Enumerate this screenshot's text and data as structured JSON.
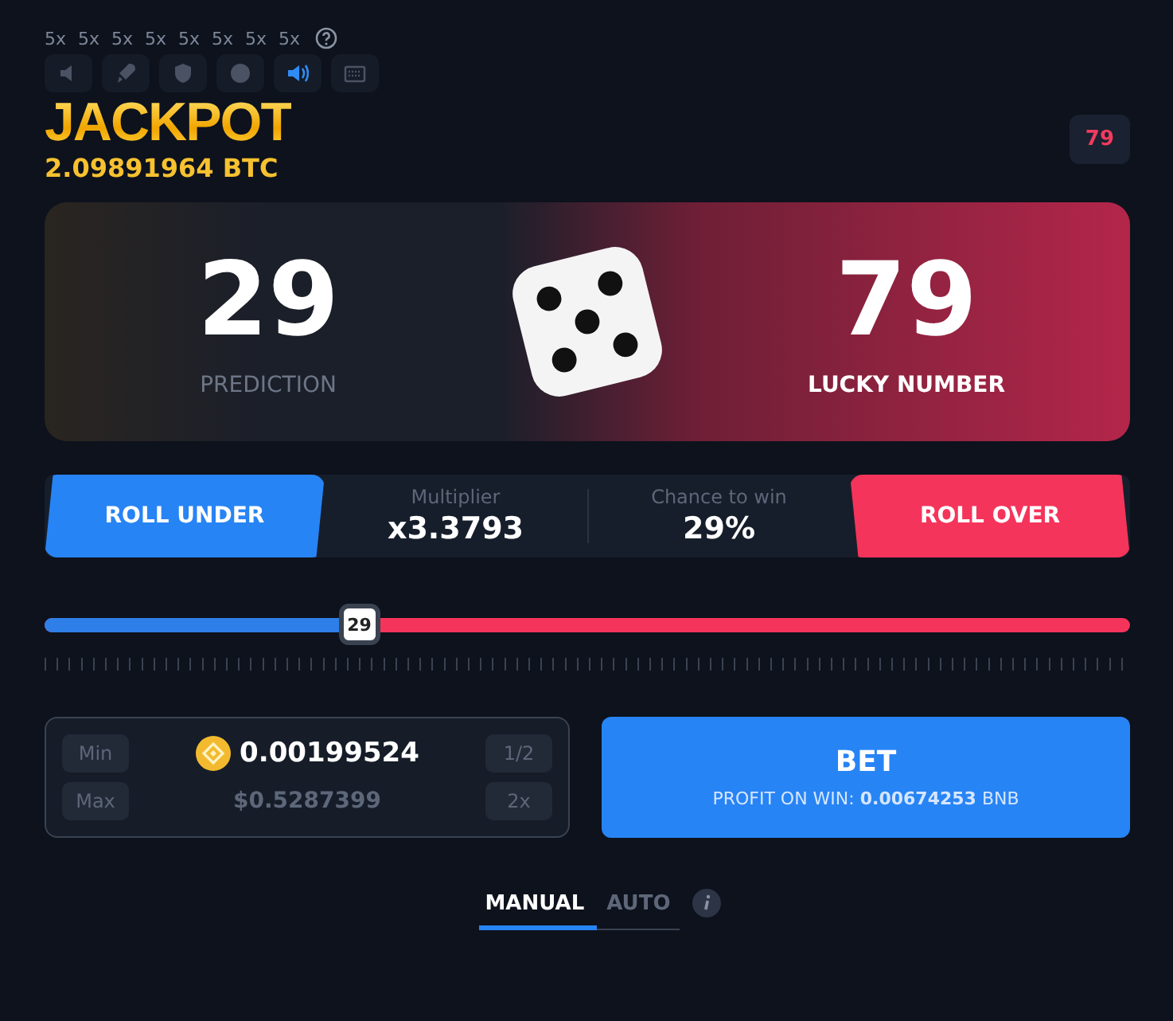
{
  "toolbar": {
    "multipliers": [
      "5x",
      "5x",
      "5x",
      "5x",
      "5x",
      "5x",
      "5x",
      "5x"
    ],
    "sound_on": true
  },
  "jackpot": {
    "title": "JACKPOT",
    "amount": "2.09891964 BTC"
  },
  "last_result": "79",
  "result": {
    "prediction": "29",
    "prediction_label": "PREDICTION",
    "lucky_number": "79",
    "lucky_label": "LUCKY NUMBER"
  },
  "mode_buttons": [
    {
      "kind": "under",
      "label": "ROLL UNDER"
    },
    {
      "kind": "over",
      "label": "ROLL OVER"
    }
  ],
  "stats": [
    {
      "label": "Multiplier",
      "value": "x3.3793"
    },
    {
      "label": "Chance to win",
      "value": "29%"
    }
  ],
  "slider": {
    "value": "29",
    "level": 0.29
  },
  "bet": {
    "amount": "0.00199524",
    "usd": "$0.5287399",
    "min": "Min",
    "max": "Max",
    "half": "1/2",
    "double": "2x"
  },
  "bet_button": {
    "label": "BET",
    "profit": "PROFIT ON WIN: **0.00674253** BNB"
  },
  "tabs": [
    {
      "label": "MANUAL",
      "selected": true
    },
    {
      "label": "AUTO",
      "selected": false
    }
  ]
}
